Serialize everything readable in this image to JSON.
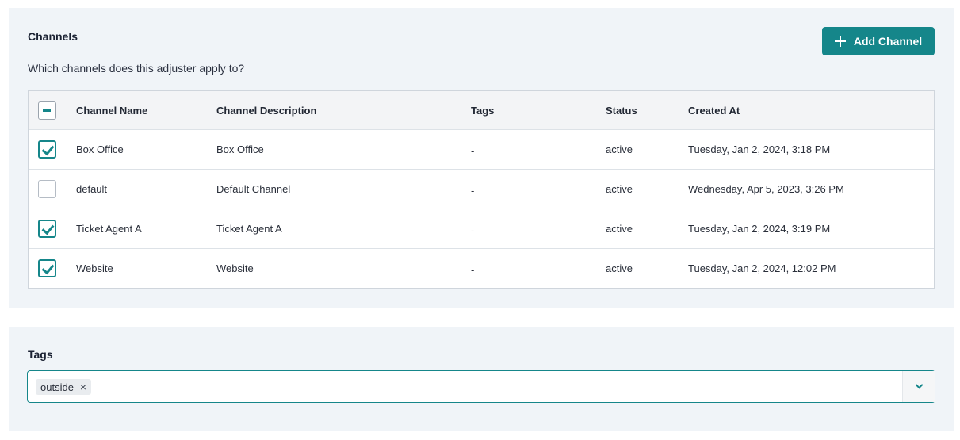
{
  "channels": {
    "title": "Channels",
    "subtitle": "Which channels does this adjuster apply to?",
    "add_button_label": "Add Channel",
    "table": {
      "header_checkbox_state": "indeterminate",
      "columns": [
        "Channel Name",
        "Channel Description",
        "Tags",
        "Status",
        "Created At"
      ],
      "rows": [
        {
          "checked": true,
          "name": "Box Office",
          "description": "Box Office",
          "tags": "-",
          "status": "active",
          "created_at": "Tuesday, Jan 2, 2024, 3:18 PM"
        },
        {
          "checked": false,
          "name": "default",
          "description": "Default Channel",
          "tags": "-",
          "status": "active",
          "created_at": "Wednesday, Apr 5, 2023, 3:26 PM"
        },
        {
          "checked": true,
          "name": "Ticket Agent A",
          "description": "Ticket Agent A",
          "tags": "-",
          "status": "active",
          "created_at": "Tuesday, Jan 2, 2024, 3:19 PM"
        },
        {
          "checked": true,
          "name": "Website",
          "description": "Website",
          "tags": "-",
          "status": "active",
          "created_at": "Tuesday, Jan 2, 2024, 12:02 PM"
        }
      ]
    }
  },
  "tags": {
    "title": "Tags",
    "selected": [
      "outside"
    ],
    "remove_icon": "×"
  },
  "colors": {
    "accent": "#15868a",
    "panel_bg": "#f0f4f8"
  }
}
